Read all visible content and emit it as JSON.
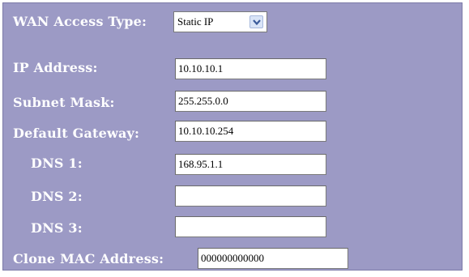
{
  "wan": {
    "access_type_label": "WAN Access Type:",
    "access_type_value": "Static IP"
  },
  "fields": {
    "ip_address": {
      "label": "IP Address:",
      "value": "10.10.10.1"
    },
    "subnet_mask": {
      "label": "Subnet Mask:",
      "value": "255.255.0.0"
    },
    "default_gateway": {
      "label": "Default Gateway:",
      "value": "10.10.10.254"
    },
    "dns1": {
      "label": "DNS 1:",
      "value": "168.95.1.1"
    },
    "dns2": {
      "label": "DNS 2:",
      "value": ""
    },
    "dns3": {
      "label": "DNS 3:",
      "value": ""
    },
    "clone_mac": {
      "label": "Clone MAC Address:",
      "value": "000000000000"
    }
  },
  "colors": {
    "panel_background": "#9c9ac5",
    "label_text": "#ffffff",
    "dropdown_arrow_bg": "#d9e4f7"
  },
  "icons": {
    "dropdown": "chevron-down-icon"
  }
}
